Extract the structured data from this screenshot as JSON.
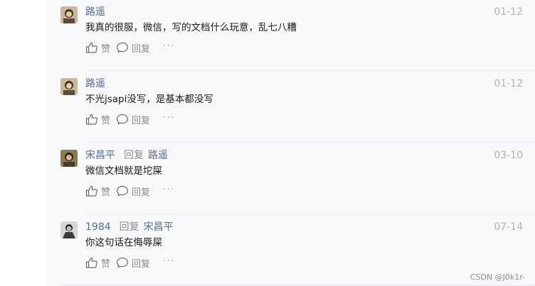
{
  "comments": [
    {
      "user": "路遥",
      "reply_word": "",
      "reply_to": "",
      "date": "01-12",
      "content": "我真的很服，微信，写的文档什么玩意，乱七八糟",
      "like_label": "赞",
      "reply_label": "回复",
      "more_label": "···"
    },
    {
      "user": "路遥",
      "reply_word": "",
      "reply_to": "",
      "date": "01-12",
      "content": "不光jsapi没写，是基本都没写",
      "like_label": "赞",
      "reply_label": "回复",
      "more_label": "···"
    },
    {
      "user": "宋昌平",
      "reply_word": "回复",
      "reply_to": "路遥",
      "date": "03-10",
      "content": "微信文档就是坨屎",
      "like_label": "赞",
      "reply_label": "回复",
      "more_label": "···"
    },
    {
      "user": "1984",
      "reply_word": "回复",
      "reply_to": "宋昌平",
      "date": "07-14",
      "content": "你这句话在侮辱屎",
      "like_label": "赞",
      "reply_label": "回复",
      "more_label": "···"
    }
  ],
  "watermark": "CSDN @J0k1r-",
  "colors": {
    "username": "#576b95",
    "date": "#b2b2b2",
    "panel_bg": "#f7f8fa"
  },
  "icons": {
    "like": "thumbs-up-icon",
    "reply": "speech-bubble-icon"
  }
}
